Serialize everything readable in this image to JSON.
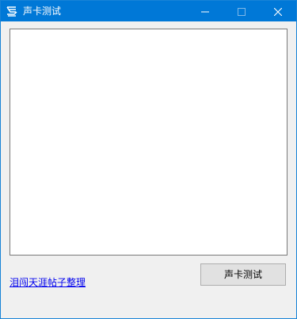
{
  "window": {
    "title": "声卡测试",
    "app_icon": "spiral-logo-icon",
    "controls": {
      "minimize": "minimize-icon",
      "maximize": "maximize-icon",
      "close": "close-icon"
    }
  },
  "main": {
    "output_text": "",
    "link_text": "泪闯天涯帖子整理",
    "test_button_label": "声卡测试"
  },
  "colors": {
    "titlebar": "#0078d7",
    "window_bg": "#f0f0f0",
    "link": "#0000ee",
    "button_bg": "#e1e1e1"
  }
}
